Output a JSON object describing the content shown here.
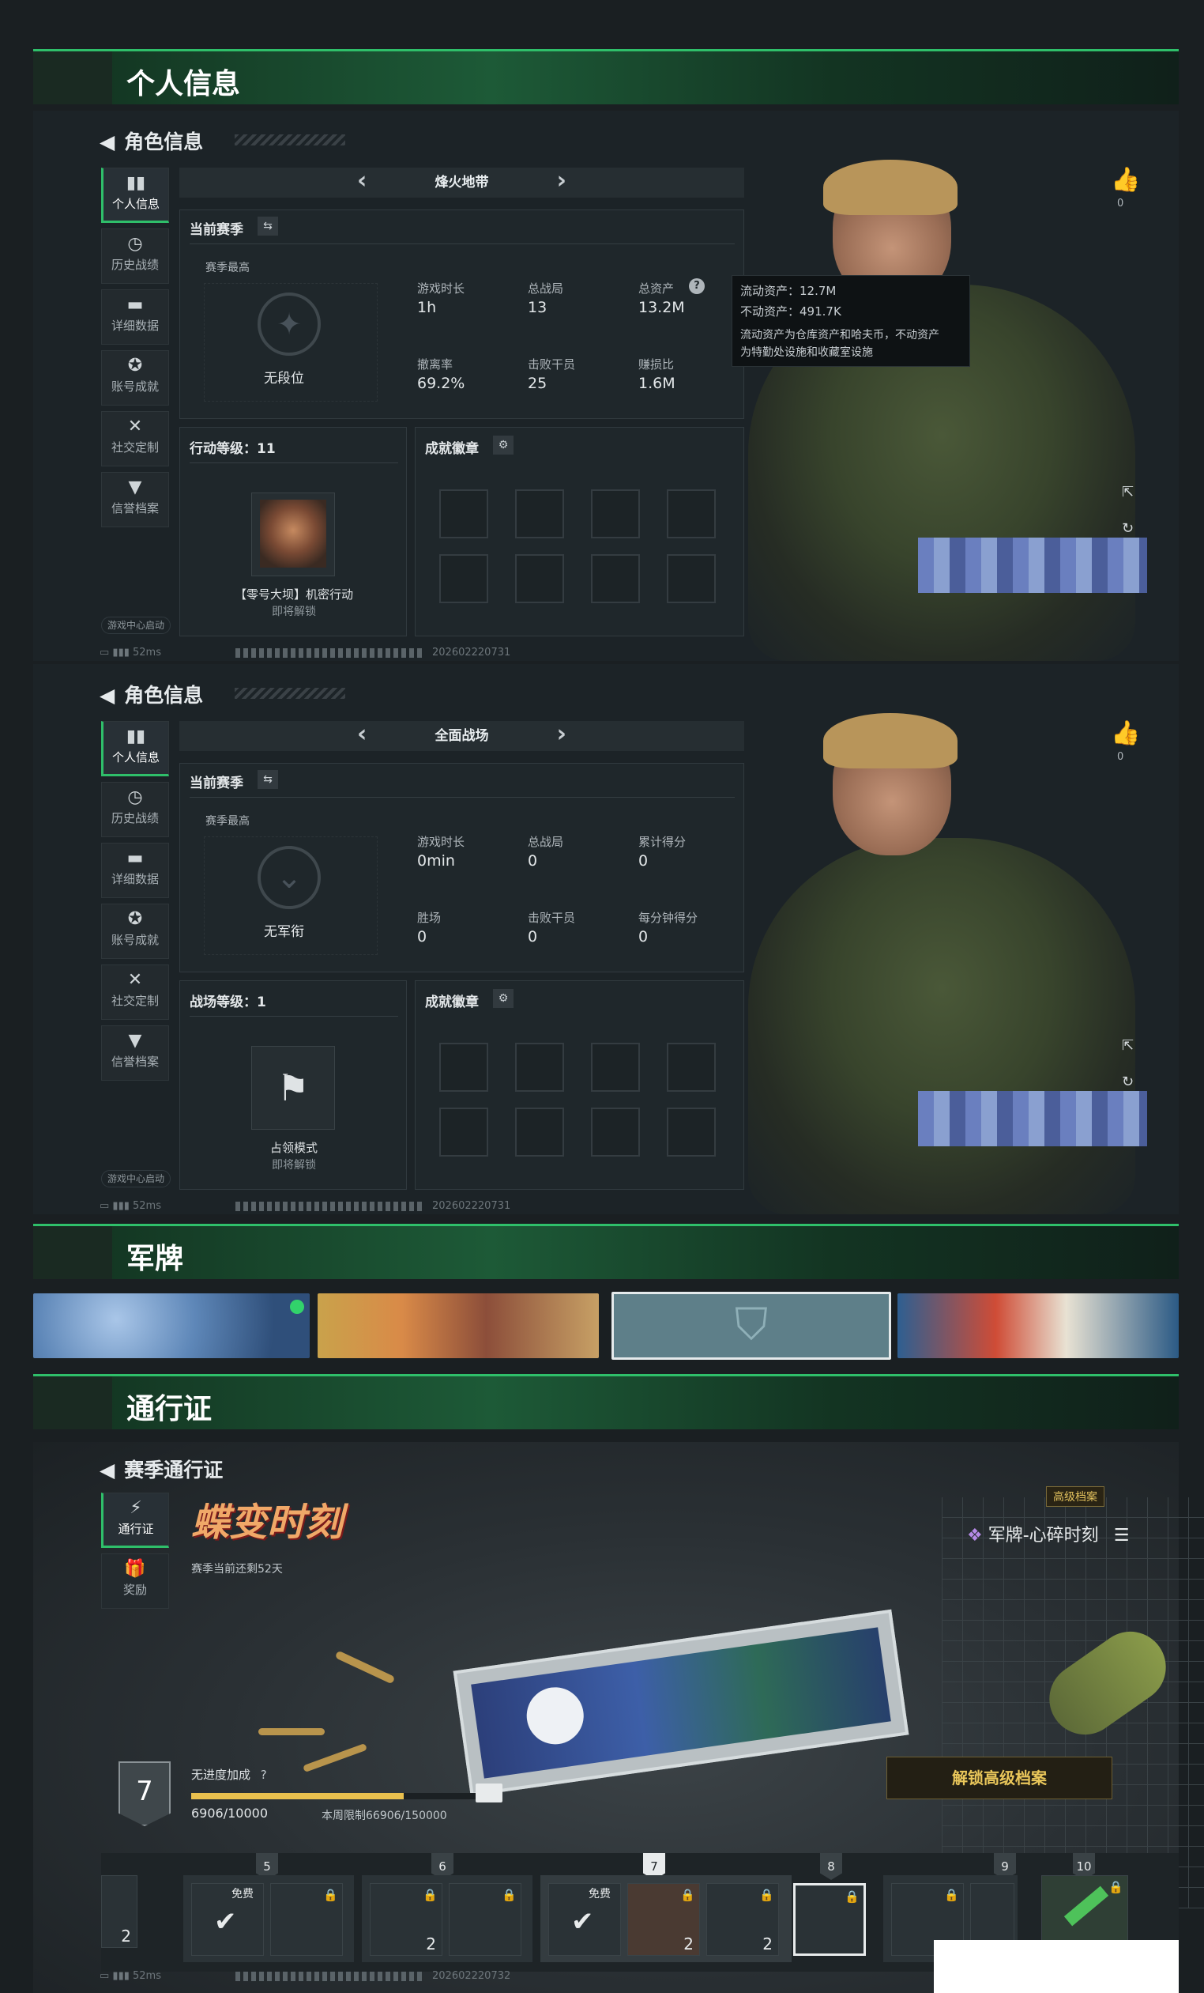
{
  "sections": {
    "personal": "个人信息",
    "dogtag": "军牌",
    "pass": "通行证"
  },
  "char_info_title": "角色信息",
  "sidebar": [
    {
      "label": "个人信息",
      "icon": "bar-chart-icon"
    },
    {
      "label": "历史战绩",
      "icon": "clock-icon"
    },
    {
      "label": "详细数据",
      "icon": "folder-icon"
    },
    {
      "label": "账号成就",
      "icon": "medal-icon"
    },
    {
      "label": "社交定制",
      "icon": "tools-icon"
    },
    {
      "label": "信誉档案",
      "icon": "shield-icon"
    }
  ],
  "startup": "游戏中心启动",
  "ping": "52ms",
  "panel1": {
    "mode": "烽火地带",
    "season_label": "当前赛季",
    "season_high": "赛季最高",
    "rank": "无段位",
    "stats": [
      {
        "label": "游戏时长",
        "value": "1h"
      },
      {
        "label": "总战局",
        "value": "13"
      },
      {
        "label": "总资产",
        "value": "13.2M"
      },
      {
        "label": "撤离率",
        "value": "69.2%"
      },
      {
        "label": "击败干员",
        "value": "25"
      },
      {
        "label": "赚损比",
        "value": "1.6M"
      }
    ],
    "level_label": "行动等级：11",
    "badges_label": "成就徽章",
    "unlock_name": "【零号大坝】机密行动",
    "unlock_note": "即将解锁",
    "tooltip": {
      "line1": "流动资产：12.7M",
      "line2": "不动资产：491.7K",
      "line3": "流动资产为仓库资产和哈夫币，不动资产",
      "line4": "为特勤处设施和收藏室设施"
    },
    "likes": "0",
    "id": "202602220731"
  },
  "panel2": {
    "mode": "全面战场",
    "season_label": "当前赛季",
    "season_high": "赛季最高",
    "rank": "无军衔",
    "stats": [
      {
        "label": "游戏时长",
        "value": "0min"
      },
      {
        "label": "总战局",
        "value": "0"
      },
      {
        "label": "累计得分",
        "value": "0"
      },
      {
        "label": "胜场",
        "value": "0"
      },
      {
        "label": "击败干员",
        "value": "0"
      },
      {
        "label": "每分钟得分",
        "value": "0"
      }
    ],
    "level_label": "战场等级：1",
    "badges_label": "成就徽章",
    "unlock_name": "占领模式",
    "unlock_note": "即将解锁",
    "likes": "0",
    "id": "202602220731"
  },
  "pass_panel": {
    "title": "赛季通行证",
    "side": [
      {
        "label": "通行证",
        "icon": "pass-icon"
      },
      {
        "label": "奖励",
        "icon": "gift-icon"
      }
    ],
    "logo": "蝶变时刻",
    "remaining": "赛季当前还剩52天",
    "tag": "高级档案",
    "reward_name": "军牌-心碎时刻",
    "level": "7",
    "bonus_label": "无进度加成",
    "progress_text": "6906/10000",
    "progress": 0.69,
    "weekly": "本周限制66906/150000",
    "unlock_btn": "解锁高级档案",
    "free": "免费",
    "track_levels": [
      "5",
      "6",
      "7",
      "8",
      "9",
      "10"
    ],
    "id": "202602220732"
  }
}
